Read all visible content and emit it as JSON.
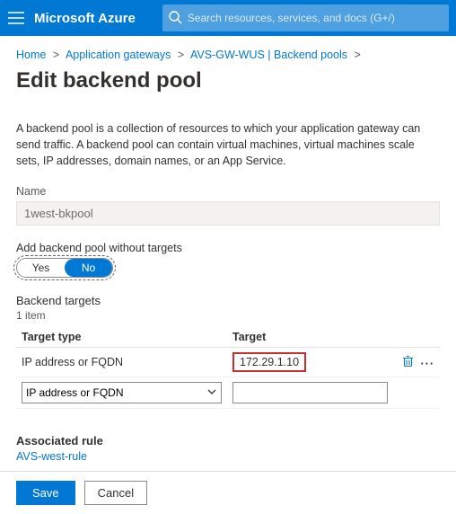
{
  "topbar": {
    "brand": "Microsoft Azure",
    "search_placeholder": "Search resources, services, and docs (G+/)"
  },
  "breadcrumb": {
    "items": [
      {
        "label": "Home"
      },
      {
        "label": "Application gateways"
      },
      {
        "label": "AVS-GW-WUS | Backend pools"
      }
    ]
  },
  "page": {
    "title": "Edit backend pool",
    "description": "A backend pool is a collection of resources to which your application gateway can send traffic. A backend pool can contain virtual machines, virtual machines scale sets, IP addresses, domain names, or an App Service."
  },
  "name_field": {
    "label": "Name",
    "value": "1west-bkpool"
  },
  "without_targets": {
    "label": "Add backend pool without targets",
    "yes": "Yes",
    "no": "No",
    "selected": "No"
  },
  "targets": {
    "heading": "Backend targets",
    "count": "1 item",
    "col_type": "Target type",
    "col_target": "Target",
    "rows": [
      {
        "type": "IP address or FQDN",
        "target": "172.29.1.10"
      }
    ],
    "new_row": {
      "type_placeholder": "IP address or FQDN",
      "target_value": ""
    }
  },
  "associated": {
    "heading": "Associated rule",
    "rule": "AVS-west-rule"
  },
  "footer": {
    "save": "Save",
    "cancel": "Cancel"
  }
}
